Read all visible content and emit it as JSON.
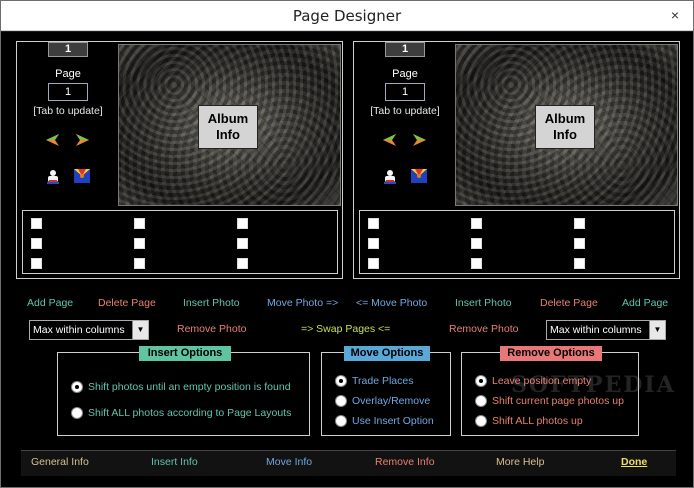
{
  "window": {
    "title": "Page Designer",
    "close_label": "×"
  },
  "left_panel": {
    "page_number": "1",
    "page_label": "Page",
    "page_input_value": "1",
    "tab_note": "[Tab to update]",
    "album_button": "Album\nInfo"
  },
  "right_panel": {
    "page_number": "1",
    "page_label": "Page",
    "page_input_value": "1",
    "tab_note": "[Tab to update]",
    "album_button": "Album\nInfo"
  },
  "actions_row1": {
    "add_page_left": "Add Page",
    "delete_page_left": "Delete Page",
    "insert_photo_left": "Insert Photo",
    "move_photo_right": "Move Photo =>",
    "move_photo_left": "<= Move Photo",
    "insert_photo_right": "Insert Photo",
    "delete_page_right": "Delete Page",
    "add_page_right": "Add Page"
  },
  "actions_row2": {
    "select_left_value": "Max within columns",
    "remove_photo_left": "Remove Photo",
    "swap_pages": "=> Swap Pages <=",
    "remove_photo_right": "Remove Photo",
    "select_right_value": "Max within columns"
  },
  "insert_options": {
    "title": "Insert Options",
    "options": [
      "Shift photos until an empty position is found",
      "Shift ALL photos according to Page Layouts"
    ],
    "selected": 0
  },
  "move_options": {
    "title": "Move Options",
    "options": [
      "Trade Places",
      "Overlay/Remove",
      "Use Insert Option"
    ],
    "selected": 0
  },
  "remove_options": {
    "title": "Remove Options",
    "options": [
      "Leave position empty",
      "Shift current page photos up",
      "Shift ALL photos up"
    ],
    "selected": 0
  },
  "footer": {
    "general_info": "General Info",
    "insert_info": "Insert Info",
    "move_info": "Move Info",
    "remove_info": "Remove Info",
    "more_help": "More Help",
    "done": "Done"
  },
  "colors": {
    "teal": "#60c4b0",
    "salmon": "#e88070",
    "blue": "#70a8e0",
    "green": "#c8e050",
    "insert_title_bg": "#60c4a0",
    "move_title_bg": "#5aa8d8",
    "remove_title_bg": "#e87878"
  },
  "watermark": "SOFTPEDIA"
}
